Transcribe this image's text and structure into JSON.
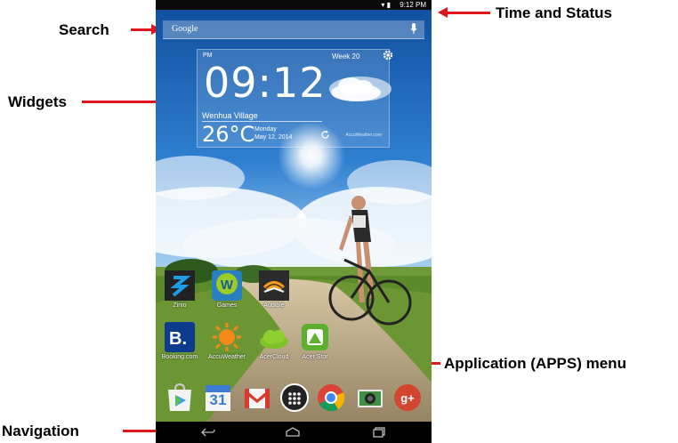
{
  "callouts": {
    "search": "Search",
    "widgets": "Widgets",
    "time_status": "Time and Status",
    "apps_menu": "Application (APPS) menu",
    "navigation": "Navigation"
  },
  "status_bar": {
    "time": "9:12 PM",
    "icons": [
      "wifi-icon",
      "battery-icon"
    ]
  },
  "search_bar": {
    "hint": "Google",
    "icon": "mic-icon"
  },
  "widget": {
    "ampm": "PM",
    "week": "Week 20",
    "time": "09:12",
    "location": "Wenhua Village",
    "temperature": "26°C",
    "day": "Monday",
    "date": "May 12, 2014",
    "provider": "AccuWeather.com",
    "icons": [
      "gear-icon",
      "cloud-icon",
      "refresh-icon"
    ]
  },
  "apps_row1": [
    {
      "name": "Zinio",
      "icon": "zinio-icon"
    },
    {
      "name": "Games",
      "icon": "games-icon"
    },
    {
      "name": "Audible",
      "icon": "audible-icon"
    }
  ],
  "apps_row2": [
    {
      "name": "Booking.com",
      "icon": "booking-icon"
    },
    {
      "name": "AccuWeather",
      "icon": "sun-icon"
    },
    {
      "name": "AcerCloud",
      "icon": "cloud-icon"
    },
    {
      "name": "Acer Stor",
      "icon": "acer-store-icon"
    }
  ],
  "dock": [
    "play-store-icon",
    "calendar-icon",
    "gmail-icon",
    "apps-menu-icon",
    "chrome-icon",
    "camera-icon",
    "google-plus-icon"
  ],
  "calendar_day": "31",
  "navigation": [
    "back-icon",
    "home-icon",
    "recents-icon"
  ],
  "colors": {
    "callout_arrow": "#e0161b",
    "sky": "#1c5fa8"
  }
}
